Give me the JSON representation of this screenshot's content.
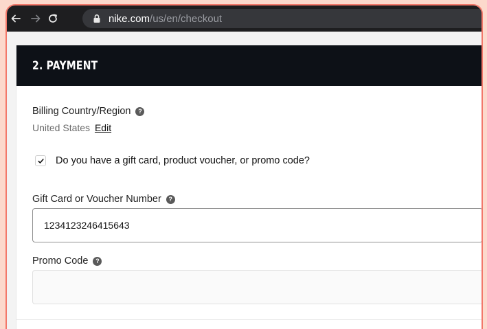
{
  "browser": {
    "url_host": "nike.com",
    "url_path": "/us/en/checkout"
  },
  "payment": {
    "title": "2. PAYMENT",
    "billing_label": "Billing Country/Region",
    "billing_country": "United States",
    "edit_label": "Edit",
    "gift_question": "Do you have a gift card, product voucher, or promo code?",
    "gift_checked": true,
    "gift_label": "Gift Card or Voucher Number",
    "gift_value": "1234123246415643",
    "promo_label": "Promo Code",
    "promo_value": "",
    "promo_placeholder": ""
  },
  "colors": {
    "header_bg": "#0d1117",
    "browser_bg": "#1e1e20",
    "frame_border": "#f3786a",
    "outer_bg": "#fcd9cc"
  },
  "icons": {
    "back": "arrow-left-icon",
    "forward": "arrow-right-icon",
    "reload": "reload-icon",
    "lock": "lock-icon",
    "help": "question-circle-icon",
    "check": "checkmark-icon"
  }
}
